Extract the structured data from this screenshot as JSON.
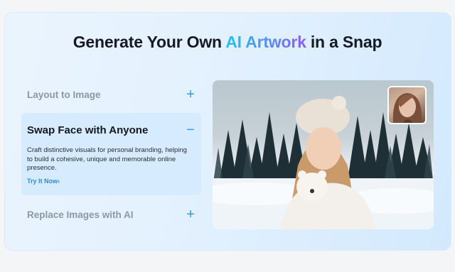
{
  "headline": {
    "before": "Generate Your Own ",
    "highlight": "AI Artwork",
    "after": " in a Snap"
  },
  "accordion": {
    "items": [
      {
        "title": "Layout to Image",
        "toggle": "+"
      },
      {
        "title": "Swap Face with Anyone",
        "toggle": "−",
        "description": "Craft distinctive visuals for personal branding, helping to build a cohesive, unique and memorable online presence.",
        "link": "Try It Now›"
      },
      {
        "title": "Replace Images with AI",
        "toggle": "+"
      }
    ]
  },
  "colors": {
    "accent": "#2d9ce8",
    "gradient": [
      "#22c4ee",
      "#4f95f3",
      "#8f5cf2"
    ]
  },
  "images": {
    "main": "woman-with-polar-bear-cub-snowy-forest",
    "swap_thumb": "swapped-face-portrait"
  }
}
